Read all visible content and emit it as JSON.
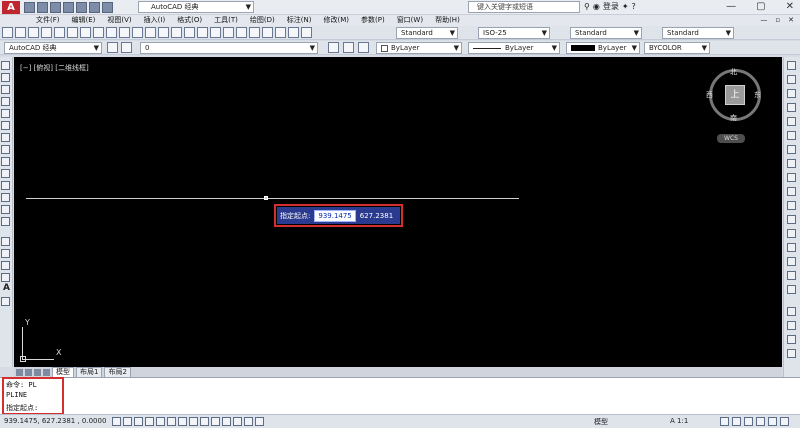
{
  "app": {
    "logo": "A",
    "workspace": "AutoCAD 经典",
    "search_placeholder": "键入关键字或短语",
    "login_label": "登录",
    "window_controls": {
      "minimize": "—",
      "restore": "▢",
      "close": "✕"
    }
  },
  "menu": {
    "items": [
      "文件(F)",
      "编辑(E)",
      "视图(V)",
      "插入(I)",
      "格式(O)",
      "工具(T)",
      "绘图(D)",
      "标注(N)",
      "修改(M)",
      "参数(P)",
      "窗口(W)",
      "帮助(H)"
    ],
    "doc_controls": {
      "minimize": "—",
      "restore": "▫",
      "close": "✕"
    }
  },
  "toolbar1": {
    "text_style": "Standard",
    "dim_style": "ISO-25",
    "table_style": "Standard",
    "mleader_style": "Standard"
  },
  "toolbar2": {
    "workspace": "AutoCAD 经典",
    "layer": "0",
    "color": "ByLayer",
    "linetype": "ByLayer",
    "lineweight": "ByLayer",
    "plotstyle": "BYCOLOR"
  },
  "viewport": {
    "label": "[−] [俯视] [二维线框]"
  },
  "dynamic_input": {
    "prompt": "指定起点:",
    "x_value": "939.1475",
    "y_value": "627.2381"
  },
  "viewcube": {
    "top": "上",
    "north": "北",
    "south": "南",
    "east": "东",
    "west": "西",
    "wcs": "WCS"
  },
  "ucs": {
    "x": "X",
    "y": "Y"
  },
  "layout_tabs": [
    "模型",
    "布局1",
    "布局2"
  ],
  "command": {
    "lines": [
      "命令: PL",
      "PLINE",
      "指定起点:"
    ]
  },
  "status": {
    "coordinates": "939.1475, 627.2381 , 0.0000",
    "model": "模型",
    "scale": "A 1:1"
  },
  "colors": {
    "canvas": "#000000",
    "highlight": "#d32f2f",
    "dyn_input_bg": "#2a3a8e"
  }
}
